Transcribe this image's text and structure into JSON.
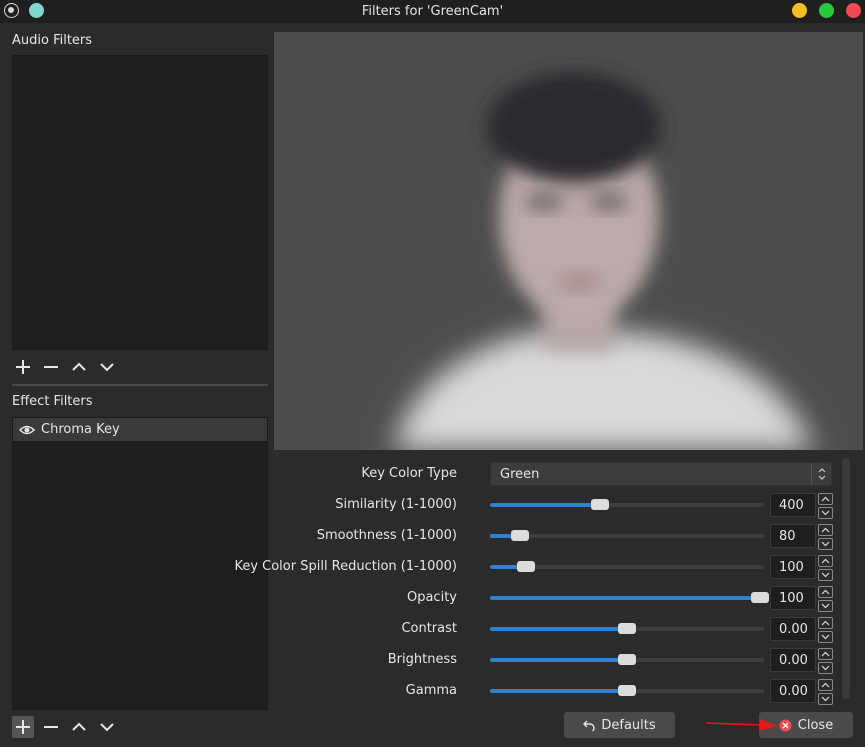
{
  "window": {
    "title": "Filters for 'GreenCam'"
  },
  "audio_filters": {
    "label": "Audio Filters",
    "items": []
  },
  "effect_filters": {
    "label": "Effect Filters",
    "items": [
      {
        "label": "Chroma Key",
        "visible": true
      }
    ]
  },
  "properties": {
    "key_color_type": {
      "label": "Key Color Type",
      "value": "Green"
    },
    "sliders": [
      {
        "label": "Similarity (1-1000)",
        "value": "400",
        "fraction": 0.4
      },
      {
        "label": "Smoothness (1-1000)",
        "value": "80",
        "fraction": 0.11
      },
      {
        "label": "Key Color Spill Reduction (1-1000)",
        "value": "100",
        "fraction": 0.13
      },
      {
        "label": "Opacity",
        "value": "100",
        "fraction": 1.0
      },
      {
        "label": "Contrast",
        "value": "0.00",
        "fraction": 0.5
      },
      {
        "label": "Brightness",
        "value": "0.00",
        "fraction": 0.5
      },
      {
        "label": "Gamma",
        "value": "0.00",
        "fraction": 0.5
      }
    ]
  },
  "buttons": {
    "defaults": "Defaults",
    "close": "Close"
  },
  "colors": {
    "accent": "#2f80d1",
    "minimize": "#f4bf24",
    "maximize": "#27c93f",
    "close": "#f04a55",
    "app_dot": "#7fd8cf",
    "annotation_arrow": "#e01b1b"
  },
  "icons": [
    "app-icon",
    "minimize-icon",
    "maximize-icon",
    "close-window-icon",
    "add-icon",
    "remove-icon",
    "move-up-icon",
    "move-down-icon",
    "eye-icon",
    "undo-icon",
    "close-circle-icon"
  ]
}
